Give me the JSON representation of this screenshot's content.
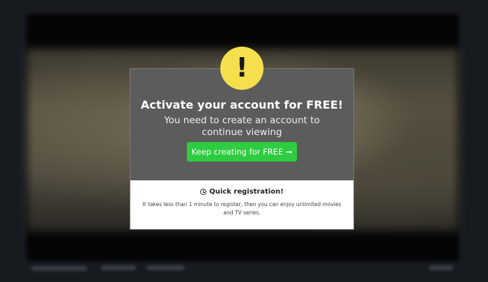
{
  "modal": {
    "title": "Activate your account for FREE!",
    "subtitle": "You need to create an account to continue viewing",
    "cta_label": "Keep creating for FREE ➞",
    "info_heading": "Quick registration!",
    "info_text": "It takes less than 1 minute to register, then you can enjoy unlimited movies and TV series.",
    "badge_glyph": "!"
  },
  "icons": {
    "badge": "alert-exclamation-icon",
    "info": "clock-icon"
  },
  "colors": {
    "badge": "#f5df4d",
    "cta": "#2ecc40",
    "modal_top": "#5c5c5c"
  }
}
